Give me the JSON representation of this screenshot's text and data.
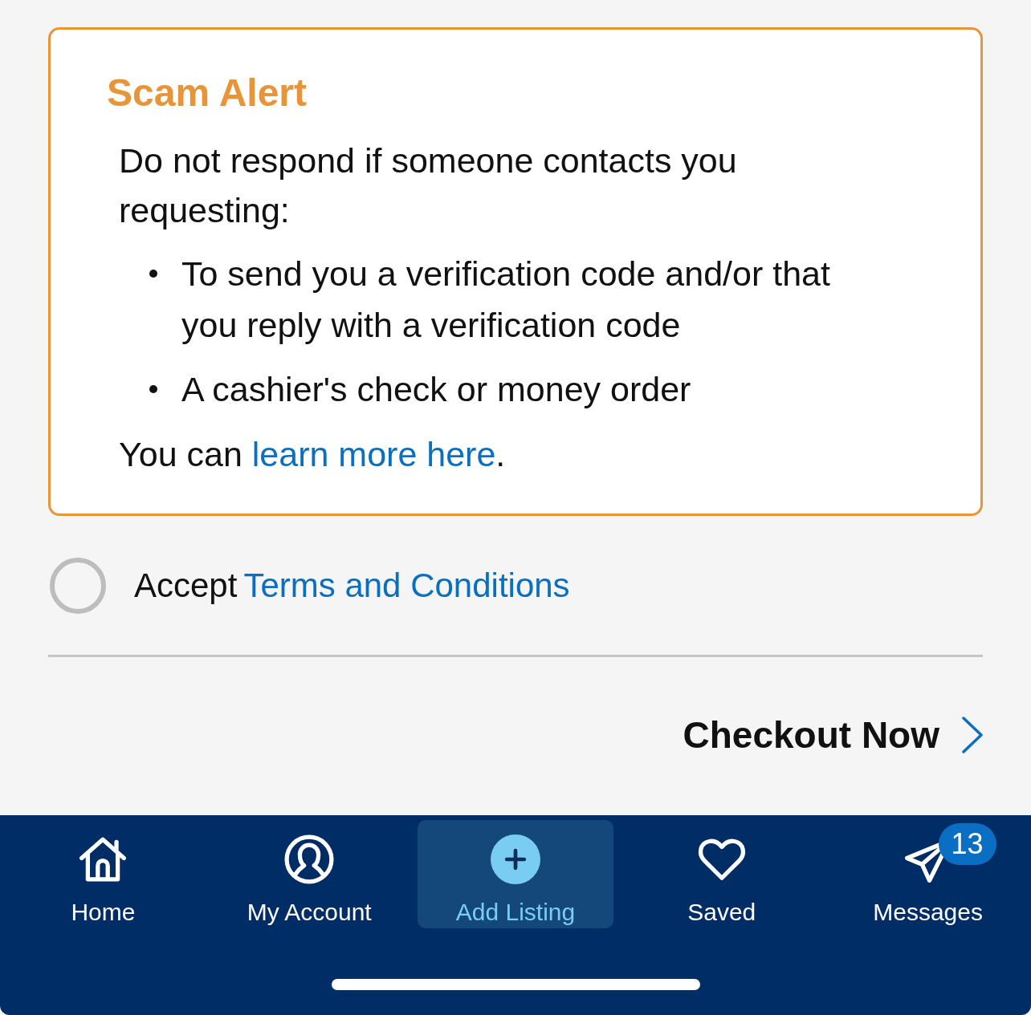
{
  "alert": {
    "title": "Scam Alert",
    "intro": "Do not respond if someone contacts you requesting:",
    "bullets": [
      "To send you a verification code and/or that you reply with a verification code",
      "A cashier's check or money order"
    ],
    "footer": {
      "before": "You can ",
      "link": "learn more here",
      "after": "."
    }
  },
  "terms": {
    "checked": false,
    "label": "Accept",
    "link": "Terms and Conditions"
  },
  "checkout": {
    "label": "Checkout Now"
  },
  "nav": [
    {
      "kind": "home",
      "label": "Home",
      "selected": false
    },
    {
      "kind": "account",
      "label": "My Account",
      "selected": false
    },
    {
      "kind": "add",
      "label": "Add Listing",
      "selected": true
    },
    {
      "kind": "saved",
      "label": "Saved",
      "selected": false
    },
    {
      "kind": "messages",
      "label": "Messages",
      "selected": false,
      "badge": "13"
    }
  ]
}
